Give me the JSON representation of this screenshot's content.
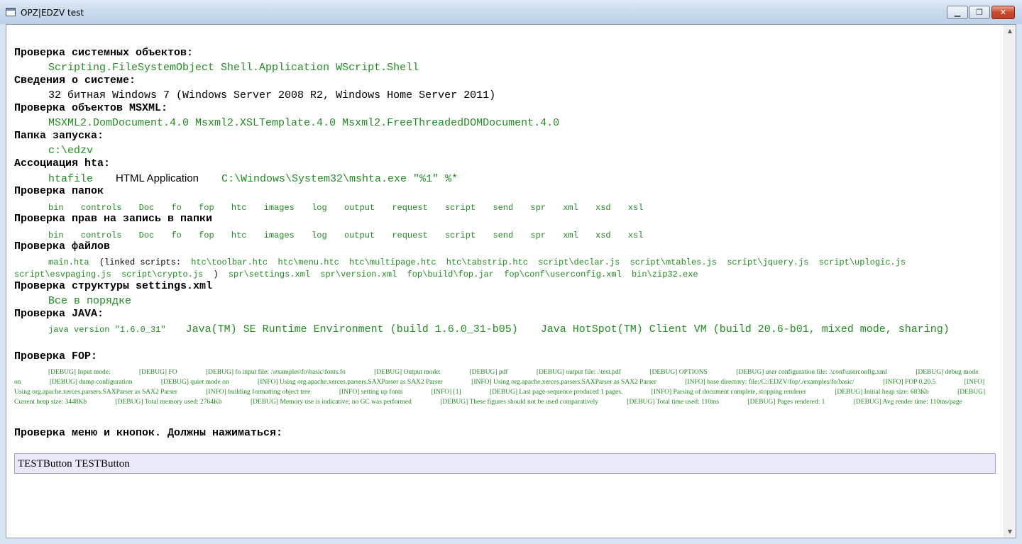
{
  "window": {
    "title": "OPZ|EDZV test"
  },
  "sections": {
    "sysobjects": {
      "heading": "Проверка системных объектов:",
      "value": "Scripting.FileSystemObject Shell.Application WScript.Shell"
    },
    "sysinfo": {
      "heading": "Сведения о системе:",
      "value": "32 битная Windows 7 (Windows Server 2008 R2, Windows Home Server 2011)"
    },
    "msxml": {
      "heading": "Проверка объектов MSXML:",
      "value": "MSXML2.DomDocument.4.0 Msxml2.XSLTemplate.4.0 Msxml2.FreeThreadedDOMDocument.4.0"
    },
    "launch": {
      "heading": "Папка запуска:",
      "value": "c:\\edzv"
    },
    "hta": {
      "heading": "Ассоциация hta:",
      "type": "htafile",
      "app": "HTML Application",
      "cmd": "C:\\Windows\\System32\\mshta.exe \"%1\" %*"
    },
    "folders": {
      "heading": "Проверка папок",
      "items": [
        "bin",
        "controls",
        "Doc",
        "fo",
        "fop",
        "htc",
        "images",
        "log",
        "output",
        "request",
        "script",
        "send",
        "spr",
        "xml",
        "xsd",
        "xsl"
      ]
    },
    "perms": {
      "heading": "Проверка прав на запись в папки",
      "items": [
        "bin",
        "controls",
        "Doc",
        "fo",
        "fop",
        "htc",
        "images",
        "log",
        "output",
        "request",
        "script",
        "send",
        "spr",
        "xml",
        "xsd",
        "xsl"
      ]
    },
    "files": {
      "heading": "Проверка файлов",
      "main": "main.hta",
      "linked_open": "(linked scripts:",
      "scripts": [
        "htc\\toolbar.htc",
        "htc\\menu.htc",
        "htc\\multipage.htc",
        "htc\\tabstrip.htc",
        "script\\declar.js",
        "script\\mtables.js",
        "script\\jquery.js",
        "script\\uplogic.js",
        "script\\esvpaging.js",
        "script\\crypto.js"
      ],
      "linked_close": ")",
      "others": [
        "spr\\settings.xml",
        "spr\\version.xml",
        "fop\\build\\fop.jar",
        "fop\\conf\\userconfig.xml",
        "bin\\zip32.exe"
      ]
    },
    "settings": {
      "heading": "Проверка структуры settings.xml",
      "value": "Все в порядке"
    },
    "java": {
      "heading": "Проверка JAVA:",
      "version": "java version \"1.6.0_31\"",
      "runtime": "Java(TM) SE Runtime Environment (build 1.6.0_31-b05)",
      "vm": "Java HotSpot(TM) Client VM (build 20.6-b01, mixed mode, sharing)"
    },
    "fop": {
      "heading": "Проверка FOP:",
      "log": [
        "[DEBUG] Input mode:",
        "[DEBUG] FO",
        "[DEBUG] fo input file: .\\examples\\fo\\basic\\fonts.fo",
        "[DEBUG] Output mode:",
        "[DEBUG] pdf",
        "[DEBUG] output file: .\\test.pdf",
        "[DEBUG] OPTIONS",
        "[DEBUG] user configuration file: .\\conf\\userconfig.xml",
        "[DEBUG] debug mode on",
        "[DEBUG] dump configuration",
        "[DEBUG] quiet mode on",
        "[INFO] Using org.apache.xerces.parsers.SAXParser as SAX2 Parser",
        "[INFO] Using org.apache.xerces.parsers.SAXParser as SAX2 Parser",
        "[INFO] base directory: file:/C:/EDZV/fop/./examples/fo/basic/",
        "[INFO] FOP 0.20.5",
        "[INFO] Using org.apache.xerces.parsers.SAXParser as SAX2 Parser",
        "[INFO] building formatting object tree",
        "[INFO] setting up fonts",
        "[INFO] [1]",
        "[DEBUG] Last page-sequence produced 1 pages.",
        "[INFO] Parsing of document complete, stopping renderer",
        "[DEBUG] Initial heap size: 683Kb",
        "[DEBUG] Current heap size: 3448Kb",
        "[DEBUG] Total memory used: 2764Kb",
        "[DEBUG] Memory use is indicative; no GC was performed",
        "[DEBUG] These figures should not be used comparatively",
        "[DEBUG] Total time used: 110ms",
        "[DEBUG] Pages rendered: 1",
        "[DEBUG] Avg render time: 110ms/page"
      ]
    },
    "menu": {
      "heading": "Проверка меню и кнопок. Должны нажиматься:",
      "buttons": [
        "TESTButton",
        "TESTButton"
      ]
    }
  },
  "colors": {
    "ok": "#228b22",
    "bar": "#e8e8f8"
  }
}
